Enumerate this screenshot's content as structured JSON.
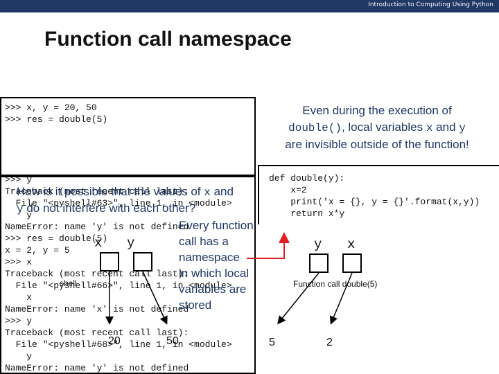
{
  "header": {
    "course_title": "Introduction to Computing Using Python"
  },
  "slide": {
    "title": "Function call namespace"
  },
  "shell": {
    "lines": [
      ">>> x, y = 20, 50",
      ">>> res = double(5)",
      ">>> y",
      "Traceback (most recent call last):",
      "  File \"<pyshell#63>\", line 1, in <module>",
      "    y",
      "NameError: name 'y' is not defined",
      ">>> res = double(5)",
      "x = 2, y = 5",
      ">>> x",
      "Traceback (most recent call last):",
      "  File \"<pyshell#66>\", line 1, in <module>",
      "    x",
      "NameError: name 'x' is not defined",
      ">>> y",
      "Traceback (most recent call last):",
      "  File \"<pyshell#68>\", line 1, in <module>",
      "    y",
      "NameError: name 'y' is not defined"
    ]
  },
  "question": {
    "line1_a": "How is it possible that the values of ",
    "x": "x",
    "and": " and",
    "y": "y",
    "line2": " do not interfere with each other?"
  },
  "note": {
    "line1": "Even during the execution of",
    "fn": "double()",
    "mid": ", local variables ",
    "x": "x",
    "and": " and ",
    "y": "y",
    "line3": "are invisible outside of the function!"
  },
  "code": {
    "lines": [
      "def double(y):",
      "    x=2",
      "    print('x = {}, y = {}'.format(x,y))",
      "    return x*y"
    ]
  },
  "side_note": {
    "lines": [
      "Every function",
      "call has a",
      "namespace",
      "in which local",
      "variables are",
      "stored"
    ]
  },
  "shell_namespace": {
    "x_label": "x",
    "y_label": "y",
    "x_value": "20",
    "y_value": "50",
    "frame_label": "shell"
  },
  "call_namespace": {
    "y_label": "y",
    "x_label": "x",
    "y_value": "5",
    "x_value": "2",
    "frame_label": "Function call double(5)"
  },
  "colors": {
    "header_bar": "#1f3864",
    "accent_text": "#1f3864",
    "arrow": "#e02020"
  }
}
